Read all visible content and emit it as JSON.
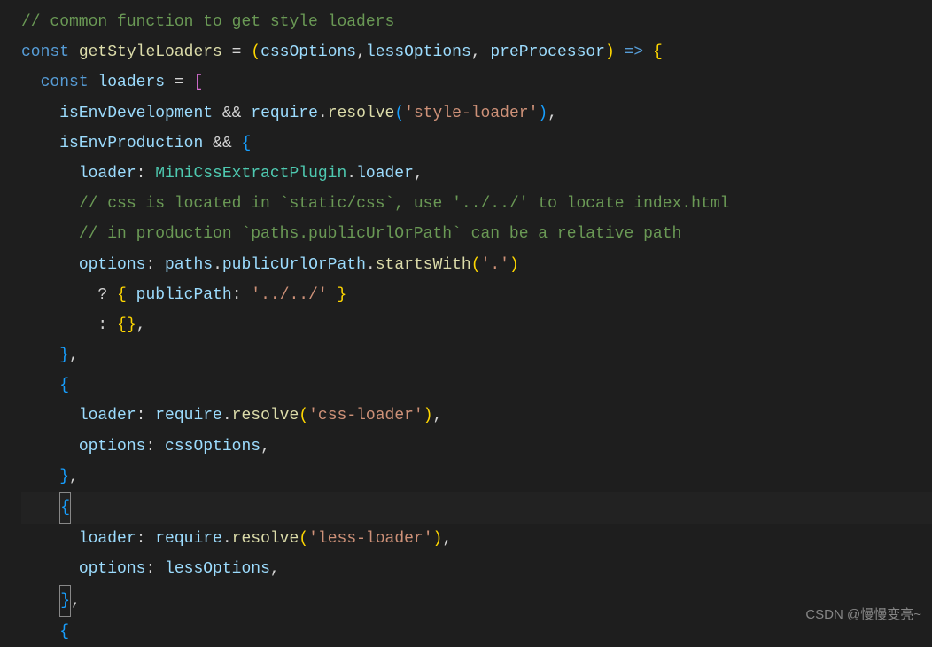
{
  "code": {
    "l1_comment": "// common function to get style loaders",
    "l2_const": "const",
    "l2_fn": "getStyleLoaders",
    "l2_eq": " = ",
    "l2_p1": "cssOptions",
    "l2_p2": "lessOptions",
    "l2_p3": "preProcessor",
    "l2_arrow": " => ",
    "l3_const": "const",
    "l3_var": "loaders",
    "l3_eq": " = ",
    "l4_v1": "isEnvDevelopment",
    "l4_and": " && ",
    "l4_req": "require",
    "l4_resolve": "resolve",
    "l4_str": "'style-loader'",
    "l5_v1": "isEnvProduction",
    "l5_and": " && ",
    "l6_prop": "loader",
    "l6_obj": "MiniCssExtractPlugin",
    "l6_p2": "loader",
    "l7_comment": "// css is located in `static/css`, use '../../' to locate index.html",
    "l8_comment": "// in production `paths.publicUrlOrPath` can be a relative path",
    "l9_prop": "options",
    "l9_obj": "paths",
    "l9_p2": "publicUrlOrPath",
    "l9_fn": "startsWith",
    "l9_str": "'.'",
    "l10_q": "? ",
    "l10_prop": "publicPath",
    "l10_str": "'../../'",
    "l11_colon": ": ",
    "l14_prop": "loader",
    "l14_req": "require",
    "l14_resolve": "resolve",
    "l14_str": "'css-loader'",
    "l15_prop": "options",
    "l15_val": "cssOptions",
    "l18_prop": "loader",
    "l18_req": "require",
    "l18_resolve": "resolve",
    "l18_str": "'less-loader'",
    "l19_prop": "options",
    "l19_val": "lessOptions"
  },
  "watermark": "CSDN @慢慢变亮~"
}
